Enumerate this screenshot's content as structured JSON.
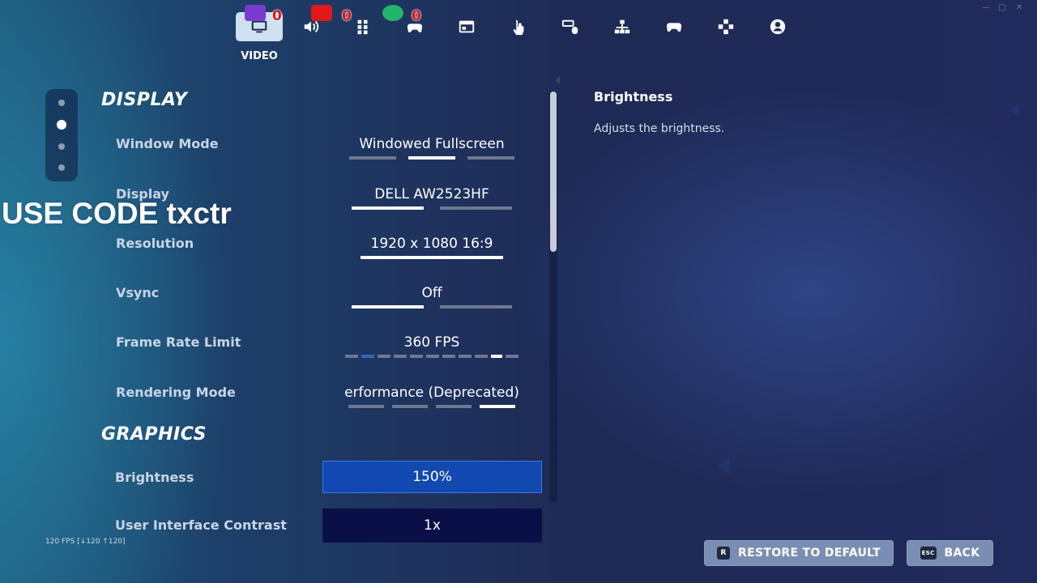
{
  "nav": {
    "active_tab_label": "VIDEO",
    "tabs": [
      {
        "icon": "monitor-icon"
      },
      {
        "icon": "speaker-icon"
      },
      {
        "icon": "grid-icon"
      },
      {
        "icon": "gamepad-icon"
      },
      {
        "icon": "window-icon"
      },
      {
        "icon": "touch-icon"
      },
      {
        "icon": "keyboard-mouse-icon"
      },
      {
        "icon": "network-icon"
      },
      {
        "icon": "controller-icon"
      },
      {
        "icon": "dpad-icon"
      },
      {
        "icon": "account-icon"
      }
    ],
    "badges": {
      "twitch": "0",
      "youtube": "0",
      "green": "0"
    }
  },
  "promo_text": "USE CODE txctr",
  "sections": {
    "display_title": "DISPLAY",
    "graphics_title": "GRAPHICS"
  },
  "settings": {
    "window_mode": {
      "label": "Window Mode",
      "value": "Windowed Fullscreen",
      "options_count": 3,
      "selected_index": 1
    },
    "display": {
      "label": "Display",
      "value": "DELL AW2523HF",
      "options_count": 2,
      "selected_index": 0
    },
    "resolution": {
      "label": "Resolution",
      "value": "1920 x 1080 16:9",
      "options_count": 1,
      "selected_index": 0
    },
    "vsync": {
      "label": "Vsync",
      "value": "Off",
      "options_count": 2,
      "selected_index": 0
    },
    "frame_rate_limit": {
      "label": "Frame Rate Limit",
      "value": "360 FPS",
      "options_count": 11,
      "selected_index": 9
    },
    "rendering_mode": {
      "label": "Rendering Mode",
      "value": "erformance (Deprecated)",
      "options_count": 4,
      "selected_index": 3
    },
    "brightness": {
      "label": "Brightness",
      "value": "150%"
    },
    "ui_contrast": {
      "label": "User Interface Contrast",
      "value": "1x"
    }
  },
  "description": {
    "title": "Brightness",
    "text": "Adjusts the brightness."
  },
  "buttons": {
    "restore_key": "R",
    "restore_label": "RESTORE TO DEFAULT",
    "back_key": "ESC",
    "back_label": "BACK"
  },
  "fps_counter": "120 FPS [↓120 ↑120]",
  "colors": {
    "accent_blue": "#1149b0",
    "dark_navy": "#0b0f48",
    "badge_red": "#e1141d"
  }
}
